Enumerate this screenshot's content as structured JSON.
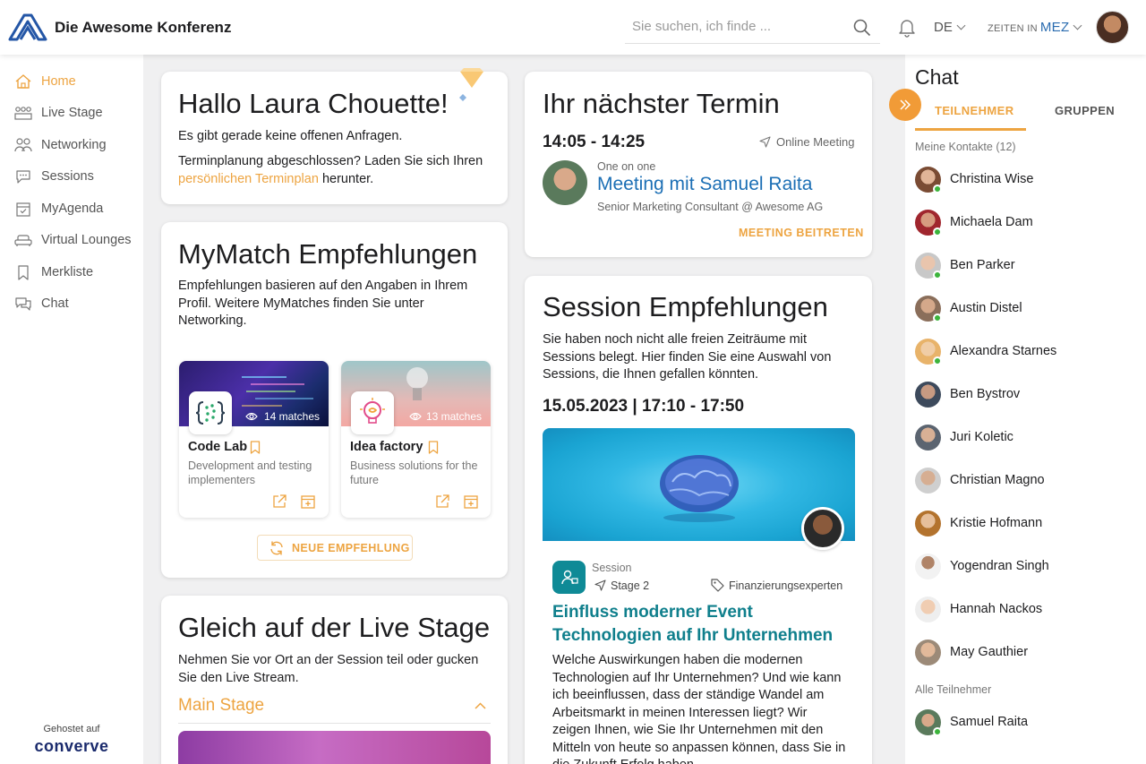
{
  "header": {
    "brand": "Die Awesome Konferenz",
    "search_placeholder": "Sie suchen, ich finde ...",
    "language": "DE",
    "timezone_label": "ZEITEN IN",
    "timezone_value": "MEZ"
  },
  "sidebar": {
    "items": [
      {
        "label": "Home",
        "icon": "home-icon",
        "active": true
      },
      {
        "label": "Live Stage",
        "icon": "live-stage-icon"
      },
      {
        "label": "Networking",
        "icon": "networking-icon"
      },
      {
        "label": "Sessions",
        "icon": "sessions-icon"
      },
      {
        "label": "MyAgenda",
        "icon": "calendar-icon"
      },
      {
        "label": "Virtual Lounges",
        "icon": "sofa-icon"
      },
      {
        "label": "Merkliste",
        "icon": "bookmark-icon"
      },
      {
        "label": "Chat",
        "icon": "chat-icon"
      }
    ],
    "hosted_label": "Gehostet auf",
    "hosted_brand": "converve"
  },
  "greeting": {
    "title": "Hallo Laura Chouette!",
    "no_requests": "Es gibt gerade keine offenen Anfragen.",
    "schedule_prefix": "Terminplanung abgeschlossen? Laden Sie sich Ihren",
    "schedule_link": "persönlichen Terminplan",
    "schedule_suffix": "herunter."
  },
  "mymatch": {
    "title": "MyMatch Empfehlungen",
    "intro": "Empfehlungen basieren auf den Angaben in Ihrem Profil. Weitere MyMatches finden Sie unter Networking.",
    "tiles": [
      {
        "matches": "14 matches",
        "title": "Code Lab",
        "desc": "Development and testing implementers"
      },
      {
        "matches": "13 matches",
        "title": "Idea factory",
        "desc": "Business solutions for the future"
      }
    ],
    "new_button": "NEUE EMPFEHLUNG"
  },
  "livestage": {
    "title": "Gleich auf der Live Stage",
    "intro": "Nehmen Sie vor Ort an der Session teil oder gucken Sie den Live Stream.",
    "stage_name": "Main Stage"
  },
  "termin": {
    "title": "Ihr nächster Termin",
    "time": "14:05 - 14:25",
    "location": "Online Meeting",
    "type": "One on one",
    "meeting_title": "Meeting mit Samuel Raita",
    "person_role": "Senior Marketing Consultant @ Awesome AG",
    "join_button": "MEETING BEITRETEN"
  },
  "sessions": {
    "title": "Session Empfehlungen",
    "intro": "Sie haben noch nicht alle freien Zeiträume mit Sessions belegt. Hier finden Sie eine Auswahl von Sessions, die Ihnen gefallen könnten.",
    "datetime": "15.05.2023 | 17:10 - 17:50",
    "kind": "Session",
    "stage": "Stage 2",
    "tag": "Finanzierungsexperten",
    "session_title_line1": "Einfluss moderner Event",
    "session_title_line2": "Technologien auf Ihr Unternehmen",
    "description": "Welche Auswirkungen haben die modernen Technologien auf Ihr Unternehmen? Und wie kann ich beeinflussen, dass der ständige Wandel am Arbeitsmarkt in meinen Interessen liegt? Wir zeigen Ihnen, wie Sie Ihr Unternehmen mit den Mitteln von heute so anpassen können, dass Sie in die Zukunft Erfolg haben."
  },
  "chat": {
    "title": "Chat",
    "tab_participants": "TEILNEHMER",
    "tab_groups": "GRUPPEN",
    "contacts_label": "Meine Kontakte (12)",
    "contacts": [
      "Christina Wise",
      "Michaela Dam",
      "Ben Parker",
      "Austin Distel",
      "Alexandra Starnes",
      "Ben Bystrov",
      "Juri Koletic",
      "Christian Magno",
      "Kristie Hofmann",
      "Yogendran Singh",
      "Hannah Nackos",
      "May Gauthier"
    ],
    "all_label": "Alle Teilnehmer",
    "all": [
      "Samuel Raita"
    ]
  },
  "colors": {
    "accent": "#eda441",
    "link_blue": "#1c6fb5",
    "teal": "#0f7f8c",
    "online": "#3cb43c"
  }
}
